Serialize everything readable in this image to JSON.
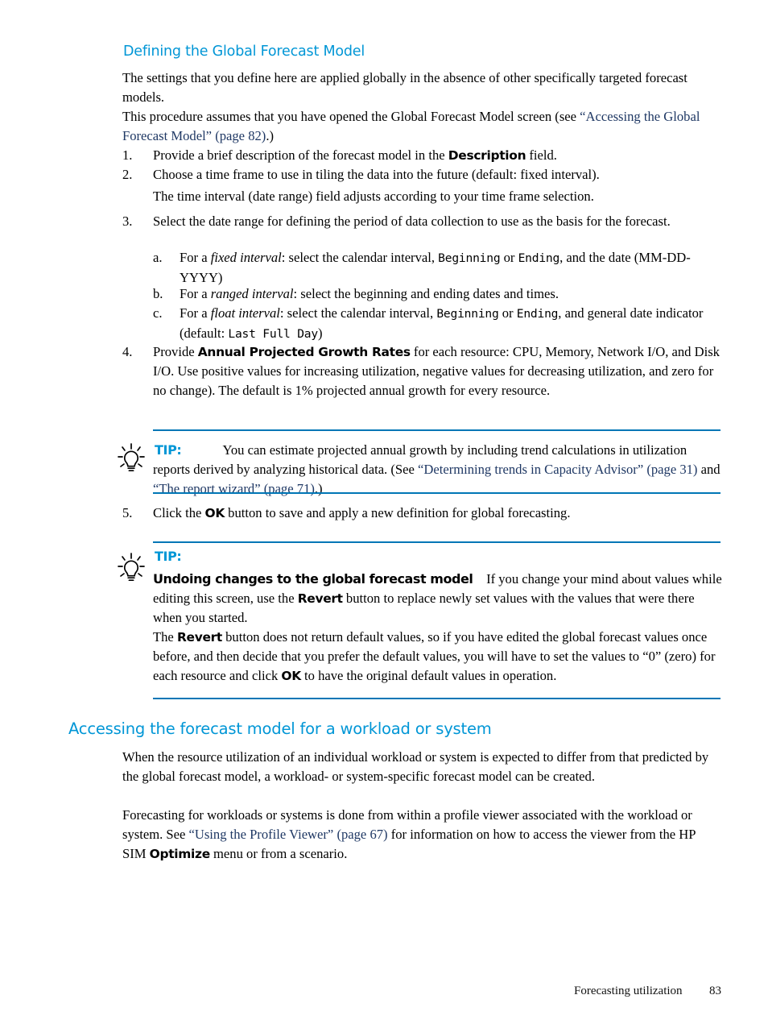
{
  "page": {
    "number": "83",
    "footer_section": "Forecasting utilization"
  },
  "colors": {
    "heading": "#0096d6",
    "link": "#1f3864",
    "rule": "#0076b6",
    "text": "#000000"
  },
  "sections": {
    "defining": {
      "heading": "Defining the Global Forecast Model",
      "intro_1": "The settings that you define here are applied globally in the absence of other specifically targeted forecast models.",
      "intro_2_pre": "This procedure assumes that you have opened the Global Forecast Model screen (see ",
      "intro_2_link": "“Accessing the Global Forecast Model” (page 82)",
      "intro_2_post": ".) "
    },
    "accessing": {
      "heading": "Accessing the forecast model for a workload or system",
      "para_1": "When the resource utilization of an individual workload or system is expected to differ from that predicted by the global forecast model, a workload- or system-specific forecast model can be created.",
      "para_2_pre": "Forecasting for workloads or systems is done from within a profile viewer associated with the workload or system. See ",
      "para_2_link": "“Using the Profile Viewer” (page 67)",
      "para_2_mid": " for information on how to access the viewer from the HP SIM ",
      "para_2_bold": "Optimize",
      "para_2_post": " menu or from a scenario."
    }
  },
  "steps": [
    {
      "marker": "1.",
      "pre": "Provide a brief description of the forecast model in the ",
      "bold": "Description",
      "post": " field."
    },
    {
      "marker": "2.",
      "pre": "Choose a time frame to use in tiling the data into the future (default: fixed interval).",
      "bold": "",
      "post": ""
    },
    {
      "marker": "3.",
      "pre": "Select the date range for defining the period of data collection to use as the basis for the forecast.",
      "bold": "",
      "post": ""
    },
    {
      "marker": "4.",
      "pre": "Provide ",
      "bold": "Annual Projected Growth Rates",
      "post": " for each resource: CPU, Memory, Network I/O, and Disk I/O. Use positive values for increasing utilization, negative values for decreasing utilization, and zero for no change). The default is 1% projected annual growth for every resource."
    },
    {
      "marker": "5.",
      "pre": "Click the ",
      "bold": "OK",
      "post": " button to save and apply a new definition for global forecasting."
    }
  ],
  "step2_note": "The time interval (date range) field adjusts according to your time frame selection.",
  "substeps": [
    {
      "marker": "a.",
      "p1": "For a ",
      "italic": "fixed interval",
      "p2": ": select the calendar interval, ",
      "mono1": "Beginning",
      "p3": " or ",
      "mono2": "Ending",
      "p4": ", and the date (MM-DD-YYYY)",
      "mono3": "",
      "p5": ""
    },
    {
      "marker": "b.",
      "p1": "For a ",
      "italic": "ranged interval",
      "p2": ": select the beginning and ending dates and times.",
      "mono1": "",
      "p3": "",
      "mono2": "",
      "p4": "",
      "mono3": "",
      "p5": ""
    },
    {
      "marker": "c.",
      "p1": "For a ",
      "italic": "float interval",
      "p2": ": select the calendar interval, ",
      "mono1": "Beginning",
      "p3": " or ",
      "mono2": "Ending",
      "p4": ", and general date indicator (default: ",
      "mono3": "Last Full Day",
      "p5": ")"
    }
  ],
  "tips": [
    {
      "label": "TIP:",
      "pre": "You can estimate projected annual growth by including trend calculations in utilization reports derived by analyzing historical data. (See ",
      "link1": "“Determining trends in Capacity Advisor” (page 31)",
      "mid": " and ",
      "link2": "“The report wizard” (page 71)",
      "post": ".)"
    },
    {
      "label": "TIP:",
      "bold_lead": "Undoing changes to the global forecast model",
      "para_1_pre": "If you change your mind about values while editing this screen, use the ",
      "para_1_bold": "Revert",
      "para_1_post": " button to replace newly set values with the values that were there when you started.",
      "para_2_pre": "The ",
      "para_2_bold1": "Revert",
      "para_2_mid": " button does not return default values, so if you have edited the global forecast values once before, and then decide that you prefer the default values, you will have to set the values to “0” (zero) for each resource and click ",
      "para_2_bold2": "OK",
      "para_2_post": " to have the original default values in operation."
    }
  ]
}
